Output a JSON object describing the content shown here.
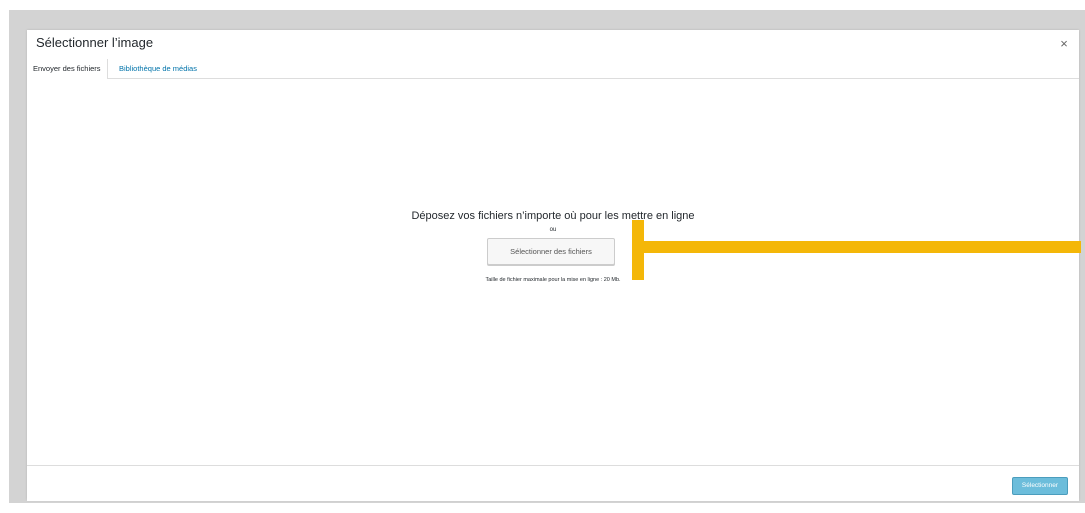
{
  "modal": {
    "title": "Sélectionner l’image",
    "close_label": "×"
  },
  "tabs": [
    {
      "label": "Envoyer des fichiers",
      "active": true
    },
    {
      "label": "Bibliothèque de médias",
      "active": false
    }
  ],
  "upload": {
    "drop_instructions": "Déposez vos fichiers n’importe où pour les mettre en ligne",
    "or_text": "ou",
    "select_files_label": "Sélectionner des fichiers",
    "max_size_text": "Taille de fichier maximale pour la mise en ligne : 20 Mb."
  },
  "footer": {
    "submit_label": "Sélectionner"
  },
  "colors": {
    "overlay": "#d3d3d3",
    "link": "#0073aa",
    "primary_button": "#2ea2cc",
    "annotation": "#f4b708"
  }
}
